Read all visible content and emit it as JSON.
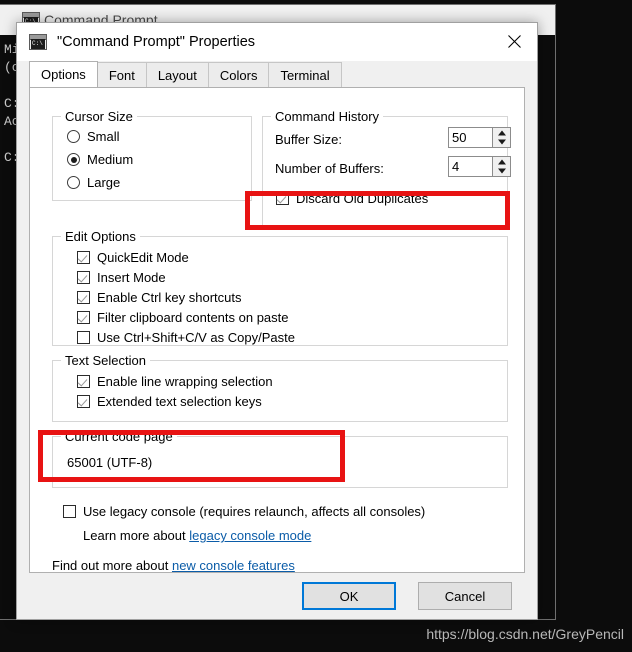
{
  "background_window": {
    "title": "Command Prompt",
    "icon": "cmd-icon",
    "console_lines": [
      "Mi",
      "(c",
      "",
      "C:",
      "Ac",
      "",
      "C:"
    ]
  },
  "dialog": {
    "title": "\"Command Prompt\" Properties",
    "icon": "cmd-icon",
    "close_icon": "close-icon",
    "tabs": [
      {
        "label": "Options",
        "selected": true
      },
      {
        "label": "Font",
        "selected": false
      },
      {
        "label": "Layout",
        "selected": false
      },
      {
        "label": "Colors",
        "selected": false
      },
      {
        "label": "Terminal",
        "selected": false
      }
    ],
    "cursor_size": {
      "title": "Cursor Size",
      "options": [
        {
          "label": "Small",
          "checked": false
        },
        {
          "label": "Medium",
          "checked": true
        },
        {
          "label": "Large",
          "checked": false
        }
      ]
    },
    "command_history": {
      "title": "Command History",
      "buffer_size_label": "Buffer Size:",
      "buffer_size_value": "50",
      "number_of_buffers_label": "Number of Buffers:",
      "number_of_buffers_value": "4",
      "discard_duplicates_label": "Discard Old Duplicates",
      "discard_duplicates_checked": true
    },
    "edit_options": {
      "title": "Edit Options",
      "items": [
        {
          "label": "QuickEdit Mode",
          "checked": true
        },
        {
          "label": "Insert Mode",
          "checked": true
        },
        {
          "label": "Enable Ctrl key shortcuts",
          "checked": true
        },
        {
          "label": "Filter clipboard contents on paste",
          "checked": true
        },
        {
          "label": "Use Ctrl+Shift+C/V as Copy/Paste",
          "checked": false
        }
      ]
    },
    "text_selection": {
      "title": "Text Selection",
      "items": [
        {
          "label": "Enable line wrapping selection",
          "checked": true
        },
        {
          "label": "Extended text selection keys",
          "checked": true
        }
      ]
    },
    "code_page": {
      "title": "Current code page",
      "value": "65001 (UTF-8)"
    },
    "legacy": {
      "checkbox_label": "Use legacy console (requires relaunch, affects all consoles)",
      "checkbox_checked": false,
      "learn_more_prefix": "Learn more about ",
      "learn_more_link": "legacy console mode",
      "find_out_prefix": "Find out more about ",
      "find_out_link": "new console features"
    },
    "footer": {
      "ok_label": "OK",
      "cancel_label": "Cancel"
    }
  },
  "annotations": {
    "highlight_color": "#e81313",
    "rects": [
      {
        "name": "discard-old-duplicates"
      },
      {
        "name": "current-code-page"
      }
    ]
  },
  "watermark": "https://blog.csdn.net/GreyPencil"
}
